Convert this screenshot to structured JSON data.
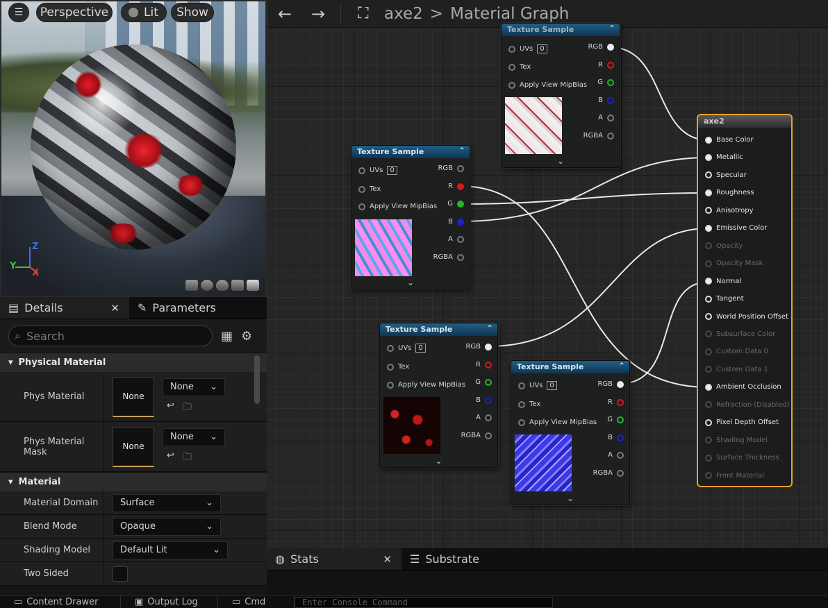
{
  "viewport": {
    "perspective_label": "Perspective",
    "lit_label": "Lit",
    "show_label": "Show",
    "axis_z": "Z",
    "axis_y": "Y",
    "axis_x": "X"
  },
  "graph": {
    "asset_name": "axe2",
    "separator": ">",
    "graph_title": "Material Graph",
    "texture_nodes": [
      {
        "title": "Texture Sample",
        "uvs": "UVs",
        "uv_index": "0",
        "tex": "Tex",
        "mipbias": "Apply View MipBias",
        "outputs": [
          "RGB",
          "R",
          "G",
          "B",
          "A",
          "RGBA"
        ]
      },
      {
        "title": "Texture Sample",
        "uvs": "UVs",
        "uv_index": "0",
        "tex": "Tex",
        "mipbias": "Apply View MipBias",
        "outputs": [
          "RGB",
          "R",
          "G",
          "B",
          "A",
          "RGBA"
        ]
      },
      {
        "title": "Texture Sample",
        "uvs": "UVs",
        "uv_index": "0",
        "tex": "Tex",
        "mipbias": "Apply View MipBias",
        "outputs": [
          "RGB",
          "R",
          "G",
          "B",
          "A",
          "RGBA"
        ]
      },
      {
        "title": "Texture Sample",
        "uvs": "UVs",
        "uv_index": "0",
        "tex": "Tex",
        "mipbias": "Apply View MipBias",
        "outputs": [
          "RGB",
          "R",
          "G",
          "B",
          "A",
          "RGBA"
        ]
      }
    ],
    "result_node": {
      "title": "axe2",
      "inputs": [
        {
          "label": "Base Color",
          "enabled": true,
          "connected": true
        },
        {
          "label": "Metallic",
          "enabled": true,
          "connected": true
        },
        {
          "label": "Specular",
          "enabled": true,
          "connected": false
        },
        {
          "label": "Roughness",
          "enabled": true,
          "connected": true
        },
        {
          "label": "Anisotropy",
          "enabled": true,
          "connected": false
        },
        {
          "label": "Emissive Color",
          "enabled": true,
          "connected": true
        },
        {
          "label": "Opacity",
          "enabled": false,
          "connected": false
        },
        {
          "label": "Opacity Mask",
          "enabled": false,
          "connected": false
        },
        {
          "label": "Normal",
          "enabled": true,
          "connected": true
        },
        {
          "label": "Tangent",
          "enabled": true,
          "connected": false
        },
        {
          "label": "World Position Offset",
          "enabled": true,
          "connected": false
        },
        {
          "label": "Subsurface Color",
          "enabled": false,
          "connected": false
        },
        {
          "label": "Custom Data 0",
          "enabled": false,
          "connected": false
        },
        {
          "label": "Custom Data 1",
          "enabled": false,
          "connected": false
        },
        {
          "label": "Ambient Occlusion",
          "enabled": true,
          "connected": true
        },
        {
          "label": "Refraction (Disabled)",
          "enabled": false,
          "connected": false
        },
        {
          "label": "Pixel Depth Offset",
          "enabled": true,
          "connected": false
        },
        {
          "label": "Shading Model",
          "enabled": false,
          "connected": false
        },
        {
          "label": "Surface Thickness",
          "enabled": false,
          "connected": false
        },
        {
          "label": "Front Material",
          "enabled": false,
          "connected": false
        }
      ]
    },
    "colors": {
      "accent": "#e8a030",
      "node_header": "#1a4b6e",
      "pin_r": "#d91a1a",
      "pin_g": "#22bb22",
      "pin_b": "#2020d0"
    }
  },
  "details": {
    "tab_details": "Details",
    "tab_parameters": "Parameters",
    "search_placeholder": "Search",
    "cat_physical": "Physical Material",
    "phys_material_label": "Phys Material",
    "phys_material_slot": "None",
    "phys_material_combo": "None",
    "phys_mask_label": "Phys Material Mask",
    "phys_mask_slot": "None",
    "phys_mask_combo": "None",
    "cat_material": "Material",
    "material_domain_label": "Material Domain",
    "material_domain_value": "Surface",
    "blend_mode_label": "Blend Mode",
    "blend_mode_value": "Opaque",
    "shading_model_label": "Shading Model",
    "shading_model_value": "Default Lit",
    "two_sided_label": "Two Sided"
  },
  "bottom": {
    "tab_stats": "Stats",
    "tab_substrate": "Substrate"
  },
  "statusbar": {
    "content_drawer": "Content Drawer",
    "output_log": "Output Log",
    "cmd": "Cmd",
    "console_placeholder": "Enter Console Command"
  }
}
